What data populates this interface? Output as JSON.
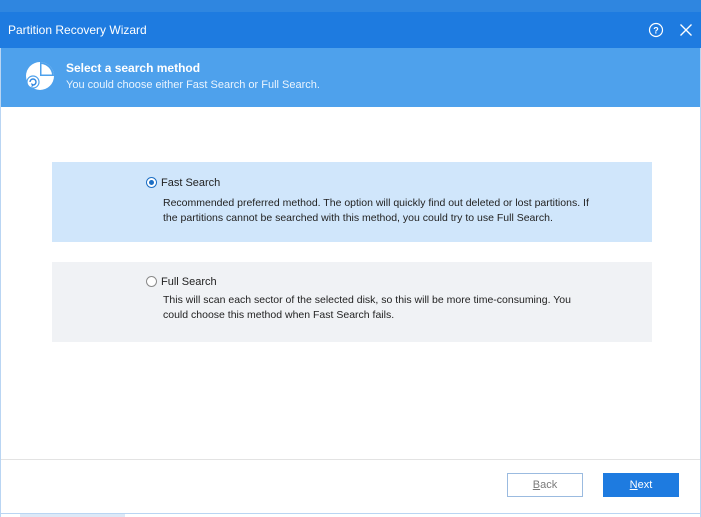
{
  "window": {
    "title": "Partition Recovery Wizard",
    "help_icon": "help-circle-icon",
    "close_icon": "close-icon"
  },
  "header": {
    "title": "Select a search method",
    "subtitle": "You could choose either Fast Search or Full Search.",
    "icon": "partition-recovery-icon"
  },
  "options": [
    {
      "label": "Fast Search",
      "description": "Recommended preferred method. The option will quickly find out deleted or lost partitions. If the partitions cannot be searched with this method, you could try to use Full Search.",
      "selected": true
    },
    {
      "label": "Full Search",
      "description": "This will scan each sector of the selected disk, so this will be more time-consuming. You could choose this method when Fast Search fails.",
      "selected": false
    }
  ],
  "footer": {
    "back_mnemonic": "B",
    "back_rest": "ack",
    "next_mnemonic": "N",
    "next_rest": "ext"
  },
  "colors": {
    "titlebar": "#1e7be0",
    "header": "#4ea1ec",
    "selected_option": "#d0e6fb",
    "unselected_option": "#f0f2f5",
    "primary_button": "#1e7be0"
  }
}
